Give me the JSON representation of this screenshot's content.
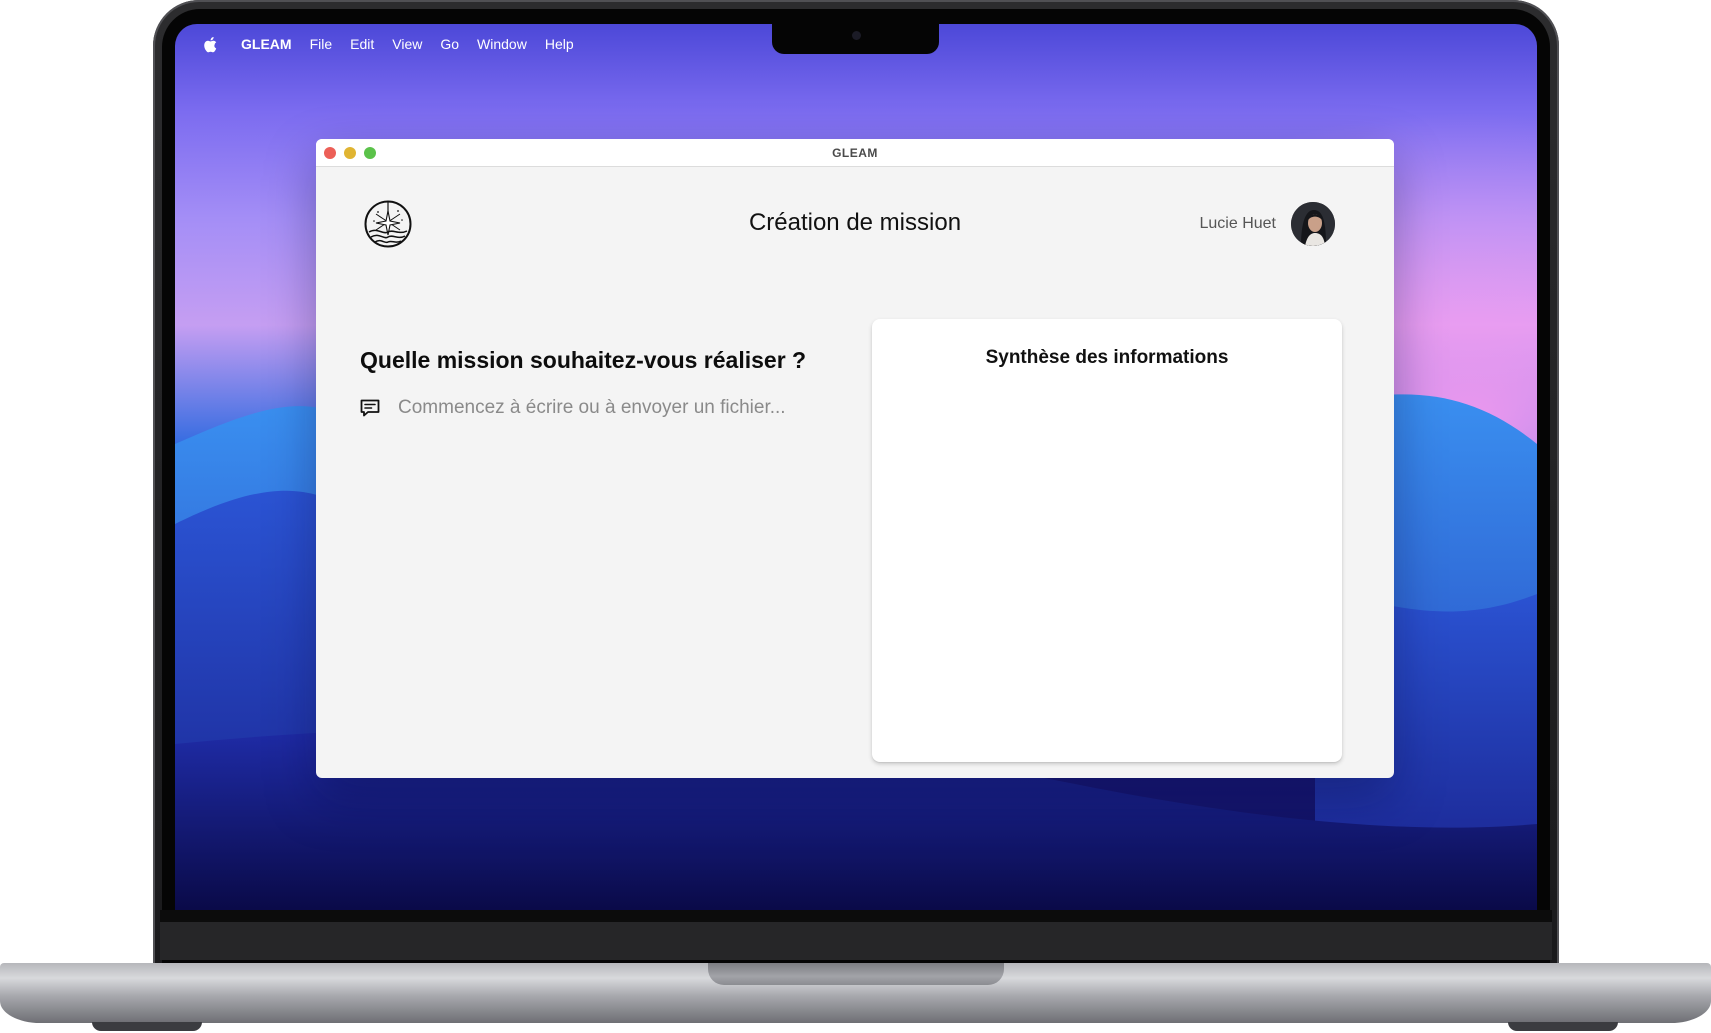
{
  "menubar": {
    "app_name": "GLEAM",
    "items": [
      "File",
      "Edit",
      "View",
      "Go",
      "Window",
      "Help"
    ]
  },
  "window": {
    "title": "GLEAM"
  },
  "header": {
    "title": "Création de mission",
    "user_name": "Lucie Huet"
  },
  "main": {
    "question": "Quelle mission souhaitez-vous réaliser ?",
    "input_value": "",
    "input_placeholder": "Commencez à écrire ou à envoyer un fichier..."
  },
  "summary": {
    "title": "Synthèse des informations"
  },
  "icons": {
    "apple": "apple-icon",
    "logo": "gleam-logo-icon",
    "chat": "chat-icon"
  },
  "colors": {
    "window_bg": "#f4f4f4",
    "card_bg": "#ffffff",
    "traffic_close": "#ec5f57",
    "traffic_min": "#e0b432",
    "traffic_max": "#5bc24a"
  }
}
